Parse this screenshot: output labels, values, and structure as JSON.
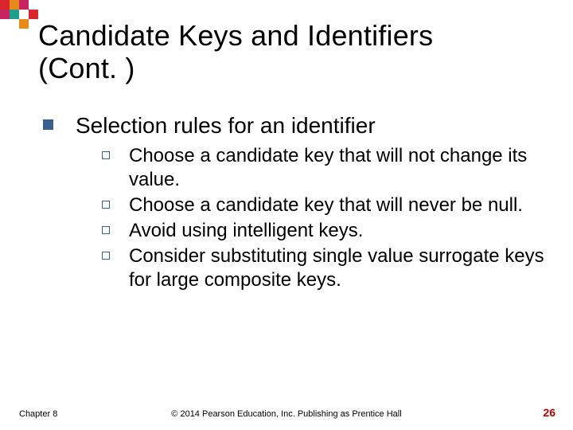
{
  "title_line1": "Candidate Keys and Identifiers",
  "title_line2": "(Cont. )",
  "section": {
    "heading": "Selection rules for an identifier",
    "items": [
      "Choose a candidate key that will not change its value.",
      "Choose a candidate key that will never be null.",
      "Avoid using intelligent keys.",
      "Consider substituting single value surrogate keys for large composite keys."
    ]
  },
  "footer": {
    "chapter": "Chapter 8",
    "copyright": "© 2014 Pearson Education, Inc. Publishing as Prentice Hall",
    "page": "26"
  },
  "logo_colors": {
    "red": "#D9262E",
    "orange": "#E88A1A",
    "magenta": "#C7255F",
    "teal": "#1E9E8B"
  }
}
